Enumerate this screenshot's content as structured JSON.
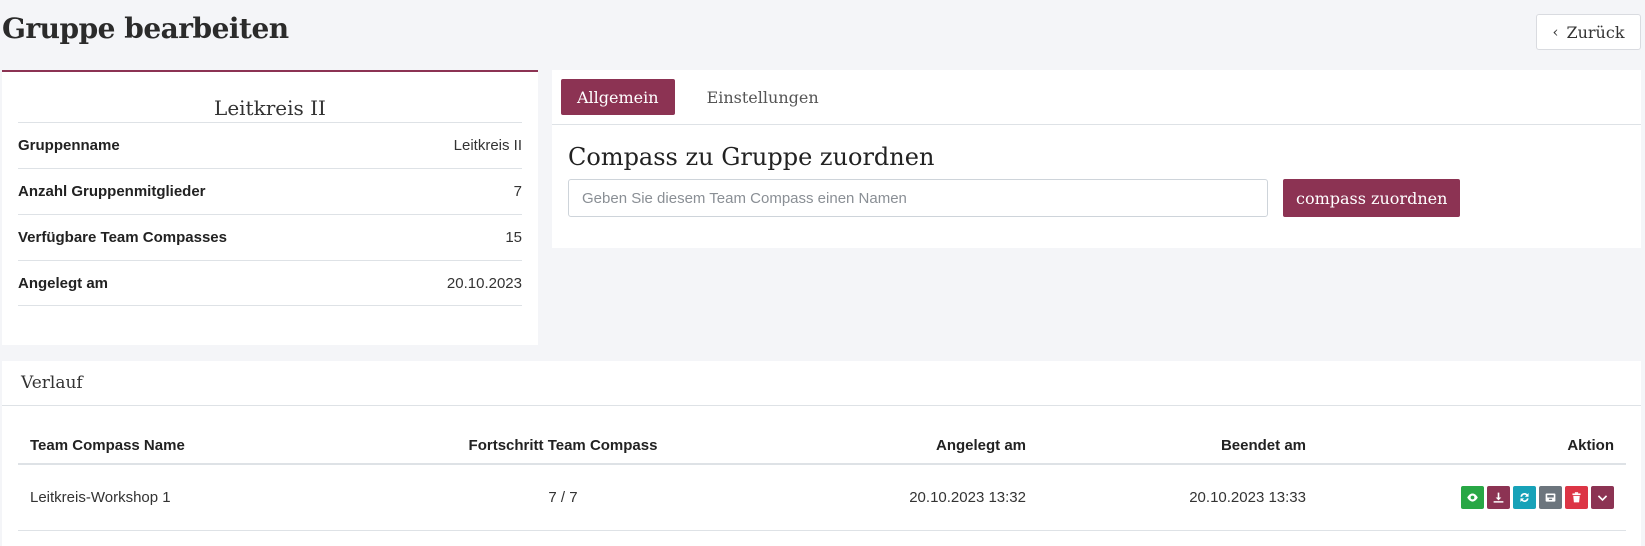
{
  "header": {
    "title": "Gruppe bearbeiten",
    "back_label": "Zurück"
  },
  "group_info": {
    "title": "Leitkreis II",
    "rows": [
      {
        "label": "Gruppenname",
        "value": "Leitkreis II"
      },
      {
        "label": "Anzahl Gruppenmitglieder",
        "value": "7"
      },
      {
        "label": "Verfügbare Team Compasses",
        "value": "15"
      },
      {
        "label": "Angelegt am",
        "value": "20.10.2023"
      }
    ]
  },
  "tabs": [
    {
      "label": "Allgemein",
      "active": true
    },
    {
      "label": "Einstellungen",
      "active": false
    }
  ],
  "assign": {
    "heading": "Compass zu Gruppe zuordnen",
    "placeholder": "Geben Sie diesem Team Compass einen Namen",
    "button_label": "compass zuordnen"
  },
  "history": {
    "title": "Verlauf",
    "columns": [
      "Team Compass Name",
      "Fortschritt Team Compass",
      "Angelegt am",
      "Beendet am",
      "Aktion"
    ],
    "rows": [
      {
        "name": "Leitkreis-Workshop 1",
        "progress": "7 / 7",
        "created": "20.10.2023 13:32",
        "finished": "20.10.2023 13:33"
      }
    ],
    "action_icons": [
      {
        "name": "eye-icon",
        "color": "#28a745"
      },
      {
        "name": "download-icon",
        "color": "#8c3353"
      },
      {
        "name": "refresh-icon",
        "color": "#17a2b8"
      },
      {
        "name": "archive-icon",
        "color": "#6c757d"
      },
      {
        "name": "trash-icon",
        "color": "#dc3545"
      },
      {
        "name": "chevron-down-icon",
        "color": "#8c3353"
      }
    ]
  },
  "colors": {
    "accent": "#8c3353",
    "background": "#f4f5f8"
  }
}
